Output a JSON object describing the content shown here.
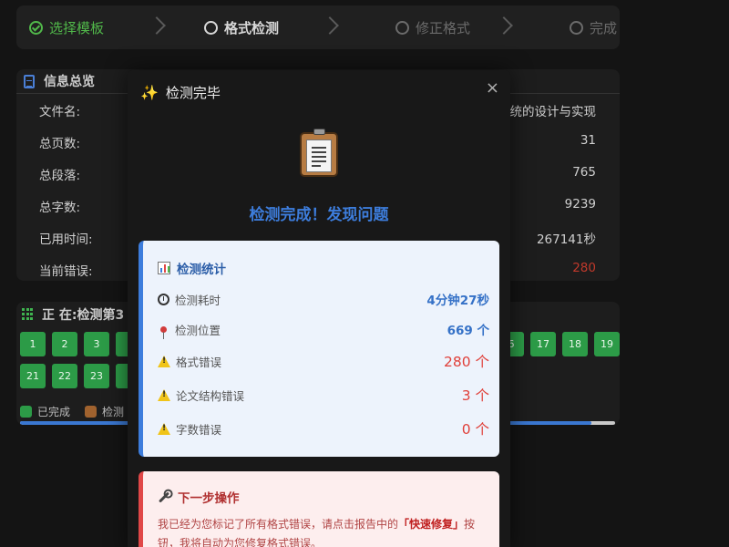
{
  "stepper": {
    "steps": [
      {
        "label": "选择模板",
        "state": "done"
      },
      {
        "label": "格式检测",
        "state": "active"
      },
      {
        "label": "修正格式",
        "state": "pending"
      },
      {
        "label": "完成",
        "state": "pending"
      }
    ]
  },
  "info": {
    "title": "信息总览",
    "rows": [
      {
        "key": "文件名:",
        "value": "统的设计与实现"
      },
      {
        "key": "总页数:",
        "value": "31"
      },
      {
        "key": "总段落:",
        "value": "765"
      },
      {
        "key": "总字数:",
        "value": "9239"
      },
      {
        "key": "已用时间:",
        "value": "267141秒"
      },
      {
        "key": "当前错误:",
        "value": "280"
      }
    ]
  },
  "progress": {
    "title": "正 在:检测第3",
    "cells_row1": [
      "1",
      "2",
      "3",
      "",
      "6",
      "17",
      "18",
      "19"
    ],
    "cells_row2": [
      "21",
      "22",
      "23",
      ""
    ],
    "legend_done": "已完成",
    "legend_checking": "检测",
    "progress_fraction": 0.96,
    "colors": {
      "done": "#2c9b47",
      "checking": "#a0622e"
    }
  },
  "modal": {
    "title": "检测完毕",
    "close": "×",
    "headline": "检测完成！发现问题",
    "stats_title": "检测统计",
    "stats": [
      {
        "label": "检测耗时",
        "value": "4分钟27秒",
        "icon": "timer-icon",
        "tone": "blue"
      },
      {
        "label": "检测位置",
        "value": "669 个",
        "icon": "pin-icon",
        "tone": "blue"
      },
      {
        "label": "格式错误",
        "value": "280 个",
        "icon": "warning-icon",
        "tone": "red"
      },
      {
        "label": "论文结构错误",
        "value": "3 个",
        "icon": "warning-icon",
        "tone": "red"
      },
      {
        "label": "字数错误",
        "value": "0 个",
        "icon": "warning-icon",
        "tone": "red"
      }
    ],
    "next_title": "下一步操作",
    "next_text_1": "我已经为您标记了所有格式错误，请点击报告中的",
    "next_text_bold": "「快速修复」",
    "next_text_2": "按钮，我将自动为您修复格式错误。"
  },
  "colors": {
    "accent": "#3d7ddc",
    "success": "#51b84a",
    "danger": "#e0403a"
  }
}
